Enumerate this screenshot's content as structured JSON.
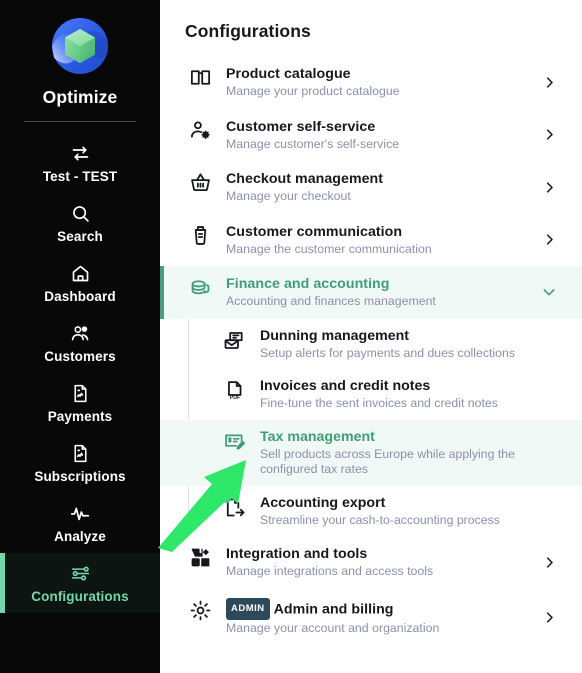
{
  "sidebar": {
    "brand": "Optimize",
    "logo_icon": "optimize-sphere-logo",
    "accent_color": "#74d6ab",
    "background_color": "#080808",
    "items": [
      {
        "label": "Test - TEST",
        "icon": "swap-arrows-icon",
        "active": false
      },
      {
        "label": "Search",
        "icon": "search-icon",
        "active": false
      },
      {
        "label": "Dashboard",
        "icon": "home-icon",
        "active": false
      },
      {
        "label": "Customers",
        "icon": "users-icon",
        "active": false
      },
      {
        "label": "Payments",
        "icon": "document-chart-icon",
        "active": false
      },
      {
        "label": "Subscriptions",
        "icon": "document-chart-icon",
        "active": false
      },
      {
        "label": "Analyze",
        "icon": "pulse-activity-icon",
        "active": false
      },
      {
        "label": "Configurations",
        "icon": "sliders-icon",
        "active": true
      }
    ]
  },
  "main": {
    "title": "Configurations",
    "accent_color": "#3f9e78",
    "highlight_background": "#f1f9f6",
    "subtitle_color": "#8b90a8",
    "rows": [
      {
        "title": "Product catalogue",
        "subtitle": "Manage your product catalogue",
        "icon": "open-book-icon",
        "chevron": "chevron-right-icon"
      },
      {
        "title": "Customer self-service",
        "subtitle": "Manage customer's self-service",
        "icon": "user-gear-icon",
        "chevron": "chevron-right-icon"
      },
      {
        "title": "Checkout management",
        "subtitle": "Manage your checkout",
        "icon": "shopping-basket-icon",
        "chevron": "chevron-right-icon"
      },
      {
        "title": "Customer communication",
        "subtitle": "Manage the customer communication",
        "icon": "megaphone-icon",
        "chevron": "chevron-right-icon"
      }
    ],
    "expanded_row": {
      "title": "Finance and accounting",
      "subtitle": "Accounting and finances management",
      "icon": "coins-stack-icon",
      "chevron": "chevron-down-icon"
    },
    "sub_rows": [
      {
        "title": "Dunning management",
        "subtitle": "Setup alerts for payments and dues collections",
        "icon": "mail-cards-icon",
        "selected": false,
        "dot": false
      },
      {
        "title": "Invoices and credit notes",
        "subtitle": "Fine-tune the sent invoices and credit notes",
        "icon": "pdf-document-icon",
        "selected": false,
        "dot": false
      },
      {
        "title": "Tax management",
        "subtitle": "Sell products across Europe while applying the configured tax rates",
        "icon": "tax-invoice-pencil-icon",
        "selected": true,
        "dot": false
      },
      {
        "title": "Accounting export",
        "subtitle": "Streamline your cash-to-accounting process",
        "icon": "export-document-icon",
        "selected": false,
        "dot": true
      }
    ],
    "footer_rows": [
      {
        "title": "Integration and tools",
        "subtitle": "Manage integrations and access tools",
        "icon": "puzzle-icon",
        "chevron": "chevron-right-icon",
        "badge": ""
      },
      {
        "title": "Admin and billing",
        "subtitle": "Manage your account and organization",
        "icon": "gear-icon",
        "chevron": "chevron-right-icon",
        "badge": "ADMIN"
      }
    ]
  },
  "annotation": {
    "type": "arrow",
    "color": "#2ee86a",
    "points_to": "Tax management"
  }
}
